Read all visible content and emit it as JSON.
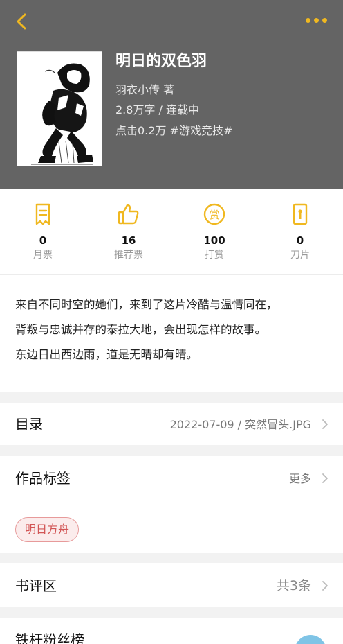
{
  "book": {
    "title": "明日的双色羽",
    "author_line": "羽衣小传  著",
    "words_status": "2.8万字 / 连载中",
    "clicks_genre": "点击0.2万  #游戏竞技#"
  },
  "stats": [
    {
      "icon": "ticket-icon",
      "value": "0",
      "label": "月票"
    },
    {
      "icon": "thumbs-up-icon",
      "value": "16",
      "label": "推荐票"
    },
    {
      "icon": "reward-coin-icon",
      "value": "100",
      "label": "打赏"
    },
    {
      "icon": "blade-icon",
      "value": "0",
      "label": "刀片"
    }
  ],
  "description": {
    "lines": [
      "来自不同时空的她们，来到了这片冷酷与温情同在，",
      "背叛与忠诚并存的泰拉大地，会出现怎样的故事。",
      "东边日出西边雨，道是无晴却有晴。"
    ]
  },
  "toc": {
    "title": "目录",
    "latest": "2022-07-09 / 突然冒头.JPG"
  },
  "tags": {
    "title": "作品标签",
    "more": "更多",
    "items": [
      "明日方舟"
    ]
  },
  "reviews": {
    "title": "书评区",
    "count": "共3条"
  },
  "fans": {
    "title": "铁杆粉丝榜"
  },
  "colors": {
    "accent": "#f0b820",
    "header_bg": "#646464",
    "tag_text": "#d25656",
    "tag_bg": "#fbecec"
  }
}
